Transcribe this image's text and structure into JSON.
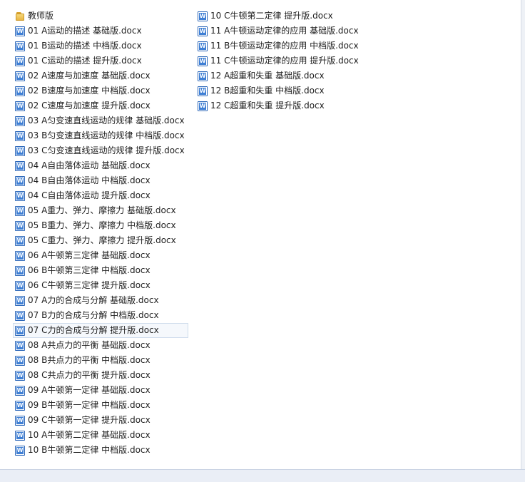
{
  "pane": {
    "col1": [
      {
        "label": "教师版",
        "type": "folder"
      },
      {
        "label": "01 A运动的描述 基础版.docx",
        "type": "doc"
      },
      {
        "label": "01 B运动的描述 中档版.docx",
        "type": "doc"
      },
      {
        "label": "01 C运动的描述 提升版.docx",
        "type": "doc"
      },
      {
        "label": "02 A速度与加速度 基础版.docx",
        "type": "doc"
      },
      {
        "label": "02 B速度与加速度 中档版.docx",
        "type": "doc"
      },
      {
        "label": "02 C速度与加速度 提升版.docx",
        "type": "doc"
      },
      {
        "label": "03 A匀变速直线运动的规律 基础版.docx",
        "type": "doc"
      },
      {
        "label": "03 B匀变速直线运动的规律 中档版.docx",
        "type": "doc"
      },
      {
        "label": "03 C匀变速直线运动的规律 提升版.docx",
        "type": "doc"
      },
      {
        "label": "04 A自由落体运动 基础版.docx",
        "type": "doc"
      },
      {
        "label": "04 B自由落体运动 中档版.docx",
        "type": "doc"
      },
      {
        "label": "04 C自由落体运动 提升版.docx",
        "type": "doc"
      },
      {
        "label": "05 A重力、弹力、摩擦力 基础版.docx",
        "type": "doc"
      },
      {
        "label": "05 B重力、弹力、摩擦力 中档版.docx",
        "type": "doc"
      },
      {
        "label": "05 C重力、弹力、摩擦力 提升版.docx",
        "type": "doc"
      },
      {
        "label": "06 A牛顿第三定律 基础版.docx",
        "type": "doc"
      },
      {
        "label": "06 B牛顿第三定律 中档版.docx",
        "type": "doc"
      },
      {
        "label": "06 C牛顿第三定律 提升版.docx",
        "type": "doc"
      },
      {
        "label": "07 A力的合成与分解 基础版.docx",
        "type": "doc"
      },
      {
        "label": "07 B力的合成与分解 中档版.docx",
        "type": "doc"
      },
      {
        "label": "07 C力的合成与分解 提升版.docx",
        "type": "doc",
        "selected": true
      },
      {
        "label": "08 A共点力的平衡 基础版.docx",
        "type": "doc"
      },
      {
        "label": "08 B共点力的平衡 中档版.docx",
        "type": "doc"
      },
      {
        "label": "08 C共点力的平衡 提升版.docx",
        "type": "doc"
      },
      {
        "label": "09 A牛顿第一定律 基础版.docx",
        "type": "doc"
      },
      {
        "label": "09 B牛顿第一定律 中档版.docx",
        "type": "doc"
      },
      {
        "label": "09 C牛顿第一定律 提升版.docx",
        "type": "doc"
      },
      {
        "label": "10 A牛顿第二定律 基础版.docx",
        "type": "doc"
      },
      {
        "label": "10 B牛顿第二定律 中档版.docx",
        "type": "doc"
      }
    ],
    "col2": [
      {
        "label": "10 C牛顿第二定律 提升版.docx",
        "type": "doc"
      },
      {
        "label": "11 A牛顿运动定律的应用 基础版.docx",
        "type": "doc"
      },
      {
        "label": "11 B牛顿运动定律的应用 中档版.docx",
        "type": "doc"
      },
      {
        "label": "11 C牛顿运动定律的应用 提升版.docx",
        "type": "doc"
      },
      {
        "label": "12 A超重和失重 基础版.docx",
        "type": "doc"
      },
      {
        "label": "12 B超重和失重 中档版.docx",
        "type": "doc"
      },
      {
        "label": "12 C超重和失重 提升版.docx",
        "type": "doc"
      }
    ]
  }
}
